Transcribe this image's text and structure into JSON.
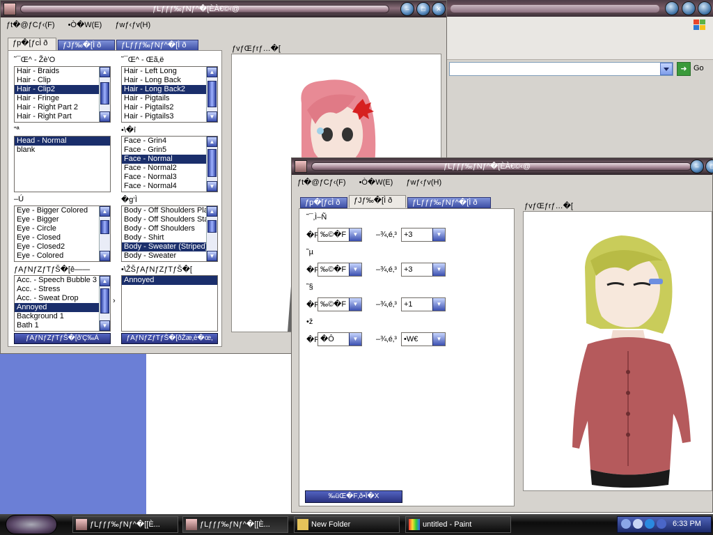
{
  "background_browser": {
    "go_label": "Go"
  },
  "window1": {
    "title": "ƒLƒƒƒ‰ƒNƒ^�[ÈÀ€©‹@",
    "menu": [
      "ƒt�@ƒCƒ‹(F)",
      "•Ò�W(E)",
      "ƒwƒ‹ƒv(H)"
    ],
    "tabs": [
      "ƒp�[ƒcÌ ð",
      "ƒJƒ‰�[Ì ð",
      "ƒLƒƒƒ‰ƒNƒ^�[Ì ð"
    ],
    "preview_label": "ƒvƒŒƒrƒ…�[",
    "groups": [
      {
        "label": "˜¯Œ^ - Žè'O",
        "items": [
          "Hair - Braids",
          "Hair - Clip",
          "Hair - Clip2",
          "Hair - Fringe",
          "Hair - Right Part 2",
          "Hair - Right Part"
        ],
        "selected": 2
      },
      {
        "label": "˜¯Œ^ - Œã‚ë",
        "items": [
          "Hair - Left Long",
          "Hair - Long Back",
          "Hair - Long Back2",
          "Hair - Pigtails",
          "Hair - Pigtails2",
          "Hair - Pigtails3"
        ],
        "selected": 2
      },
      {
        "label": "“ª",
        "items": [
          "Head - Normal",
          "blank"
        ],
        "selected": 0
      },
      {
        "label": "•\\�î",
        "items": [
          "Face - Grin4",
          "Face - Grin5",
          "Face - Normal",
          "Face - Normal2",
          "Face - Normal3",
          "Face - Normal4"
        ],
        "selected": 2
      },
      {
        "label": "–Ú",
        "items": [
          "Eye - Bigger Colored",
          "Eye - Bigger",
          "Eye - Circle",
          "Eye - Closed",
          "Eye - Closed2",
          "Eye - Colored"
        ],
        "selected": -1
      },
      {
        "label": "�g‘Ì",
        "items": [
          "Body - Off Shoulders Pla",
          "Body - Off Shoulders Sta",
          "Body - Off Shoulders",
          "Body - Shirt",
          "Body - Sweater (Striped)",
          "Body - Sweater"
        ],
        "selected": 4
      },
      {
        "label": "ƒAƒNƒZƒTƒŠ�[ê——",
        "items": [
          "Acc. - Speech Bubble 3",
          "Acc. - Stress",
          "Acc. - Sweat Drop",
          "Annoyed",
          "Background 1",
          "Bath 1"
        ],
        "selected": 3
      },
      {
        "label": "•\\ŽŠƒAƒNƒZƒTƒŠ�[",
        "items": [
          "Annoyed"
        ],
        "selected": 0
      }
    ],
    "arrow": "›",
    "btn_left": "ƒAƒNƒZƒTƒŠ�[ð'Ç‰Á",
    "btn_right": "ƒAƒNƒZƒTƒŠ�[ðŽæ‚è�œ‚­"
  },
  "window2": {
    "title": "ƒLƒƒƒ‰ƒNƒ^�[ÈÀ€©‹@",
    "menu": [
      "ƒt�@ƒCƒ‹(F)",
      "•Ò�W(E)",
      "ƒwƒ‹ƒv(H)"
    ],
    "tabs": [
      "ƒp�[ƒcÌ ð",
      "ƒJƒ‰�[Ì ð",
      "ƒLƒƒƒ‰ƒNƒ^�[Ì ð"
    ],
    "preview_label": "ƒvƒŒƒrƒ…�[",
    "rows": [
      {
        "label": "˜¯‚Ì–Ñ",
        "f1_prefix": "�F",
        "f1": "‰©�F",
        "f2_label": "–¾‚é‚³",
        "f2": "+3"
      },
      {
        "label": "˜µ",
        "f1_prefix": "�F",
        "f1": "‰©�F",
        "f2_label": "–¾‚é‚³",
        "f2": "+3"
      },
      {
        "label": "˜§",
        "f1_prefix": "�F",
        "f1": "‰©�F",
        "f2_label": "–¾‚é‚³",
        "f2": "+1"
      },
      {
        "label": "•ž",
        "f1_prefix": "�F",
        "f1": "�Ô",
        "f2_label": "–¾‚é‚³",
        "f2": "•W€"
      }
    ],
    "apply_button": "‰üŒ�F‚ð•Ï�X"
  },
  "taskbar": {
    "buttons": [
      "ƒLƒƒƒ‰ƒNƒ^�[[È...",
      "ƒLƒƒƒ‰ƒNƒ^�[[È...",
      "New Folder",
      "untitled - Paint"
    ],
    "clock": "6:33 PM"
  }
}
